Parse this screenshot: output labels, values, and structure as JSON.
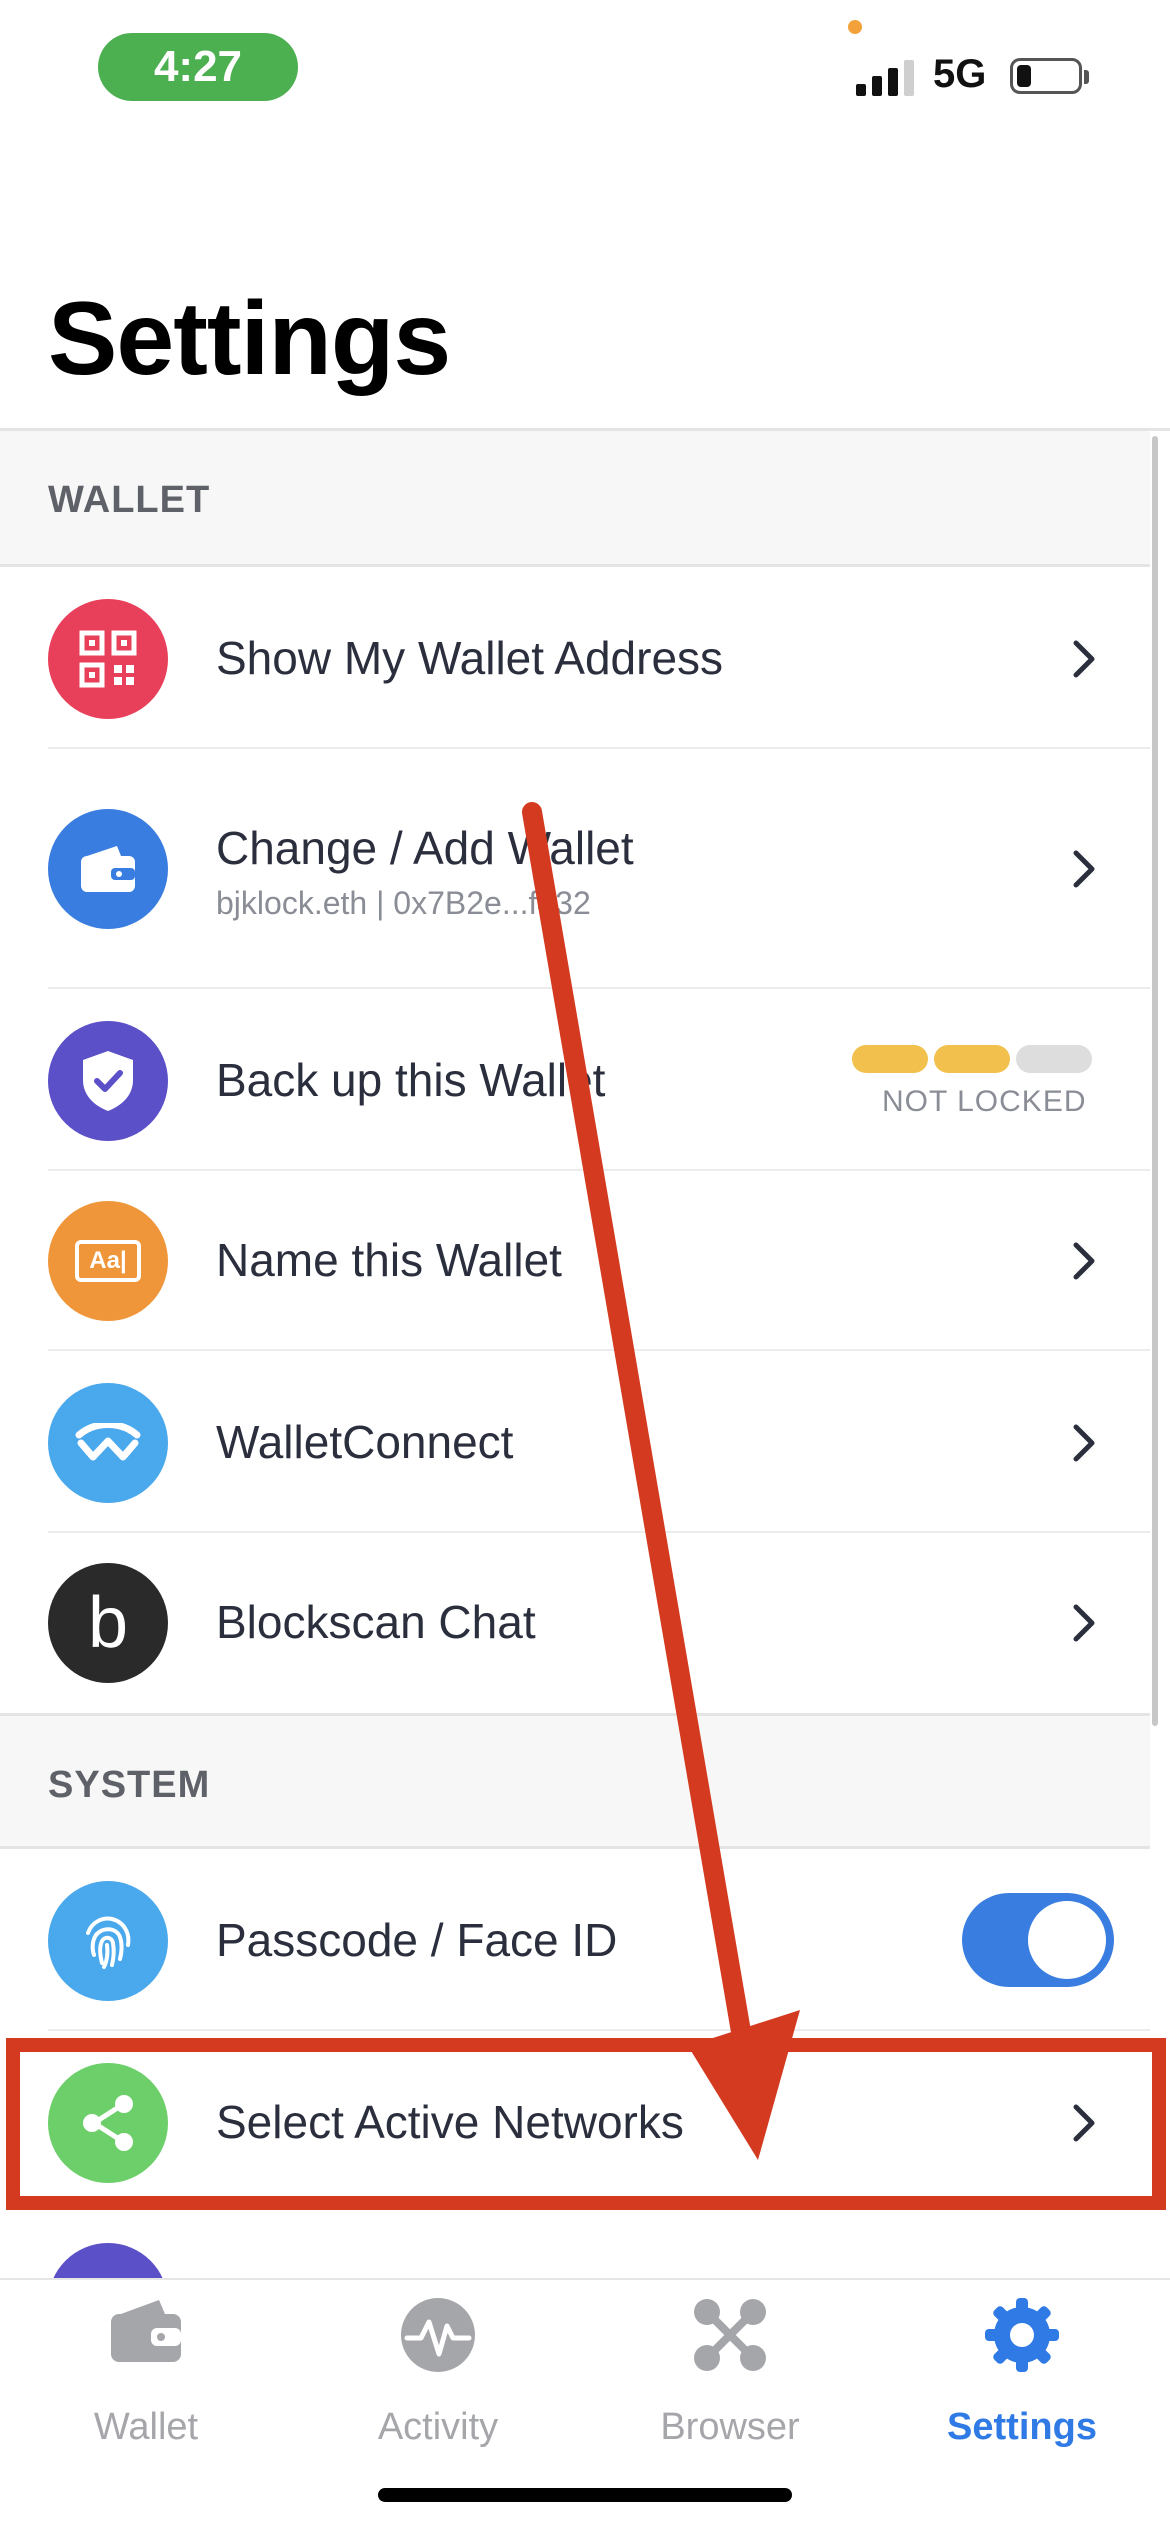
{
  "status_bar": {
    "time": "4:27",
    "network": "5G"
  },
  "page": {
    "title": "Settings"
  },
  "sections": {
    "wallet": {
      "header": "WALLET"
    },
    "system": {
      "header": "SYSTEM"
    }
  },
  "rows": {
    "show_address": {
      "label": "Show My Wallet Address"
    },
    "change_wallet": {
      "label": "Change / Add Wallet",
      "sublabel": "bjklock.eth | 0x7B2e...f432"
    },
    "backup": {
      "label": "Back up this Wallet",
      "status": "NOT LOCKED",
      "progress_segments_filled": 2,
      "progress_segments_total": 3
    },
    "name_wallet": {
      "label": "Name this Wallet",
      "icon_text": "Aa|"
    },
    "walletconnect": {
      "label": "WalletConnect"
    },
    "blockscan": {
      "label": "Blockscan Chat",
      "icon_text": "b"
    },
    "passcode": {
      "label": "Passcode / Face ID",
      "toggle_on": true
    },
    "networks": {
      "label": "Select Active Networks"
    }
  },
  "tabs": [
    {
      "label": "Wallet",
      "icon": "wallet-icon",
      "active": false
    },
    {
      "label": "Activity",
      "icon": "activity-icon",
      "active": false
    },
    {
      "label": "Browser",
      "icon": "browser-icon",
      "active": false
    },
    {
      "label": "Settings",
      "icon": "settings-gear-icon",
      "active": true
    }
  ],
  "colors": {
    "accent": "#2f7ae5",
    "annotation_red": "#d43a20",
    "icon_qr": "#e8405a",
    "icon_wallet": "#3a7de0",
    "icon_shield": "#5b50c8",
    "icon_name": "#f0963a",
    "icon_walletconnect": "#4aa8ec",
    "icon_blockscan": "#2a2a2a",
    "icon_fingerprint": "#4aa8ec",
    "icon_network": "#6ccf6a",
    "progress_filled": "#f2c04c",
    "progress_empty": "#dddddd"
  }
}
